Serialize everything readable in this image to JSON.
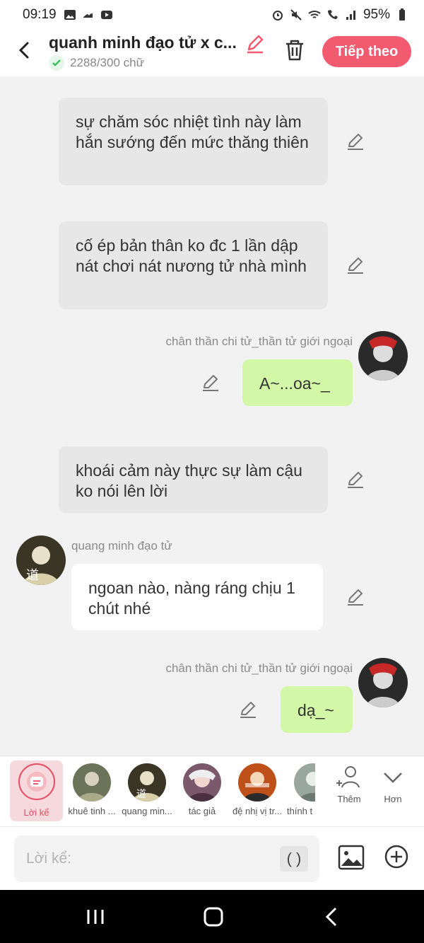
{
  "status": {
    "time": "09:19",
    "battery": "95%"
  },
  "header": {
    "title": "quanh minh đạo tử x c...",
    "count": "2288/300 chữ",
    "next_label": "Tiếp theo"
  },
  "messages": {
    "m1": "sự chăm sóc nhiệt tình này làm hắn sướng đến mức thăng thiên",
    "m2": "cố ép bản thân ko đc 1 lần dập nát chơi nát nương tử nhà mình",
    "m3_name": "chân thần chi tử_thần tử giới ngoại",
    "m3": "A~...oa~_",
    "m4": "khoái cảm này thực sự làm cậu ko nói lên lời",
    "m5_name": "quang minh đạo tử",
    "m5": "ngoan nào, nàng ráng chịu 1 chút nhé",
    "m6_name": "chân thần chi tử_thần tử giới ngoại",
    "m6": "dạ_~"
  },
  "characters": {
    "narrator": "Lời kể",
    "c1": "khuê tinh ...",
    "c2": "quang min...",
    "c3": "tác giả",
    "c4": "đệ nhị vị tr...",
    "c5": "thính t"
  },
  "tools": {
    "add": "Thêm",
    "more": "Hơn"
  },
  "input": {
    "placeholder": "Lời kể:",
    "paren": "( )"
  }
}
